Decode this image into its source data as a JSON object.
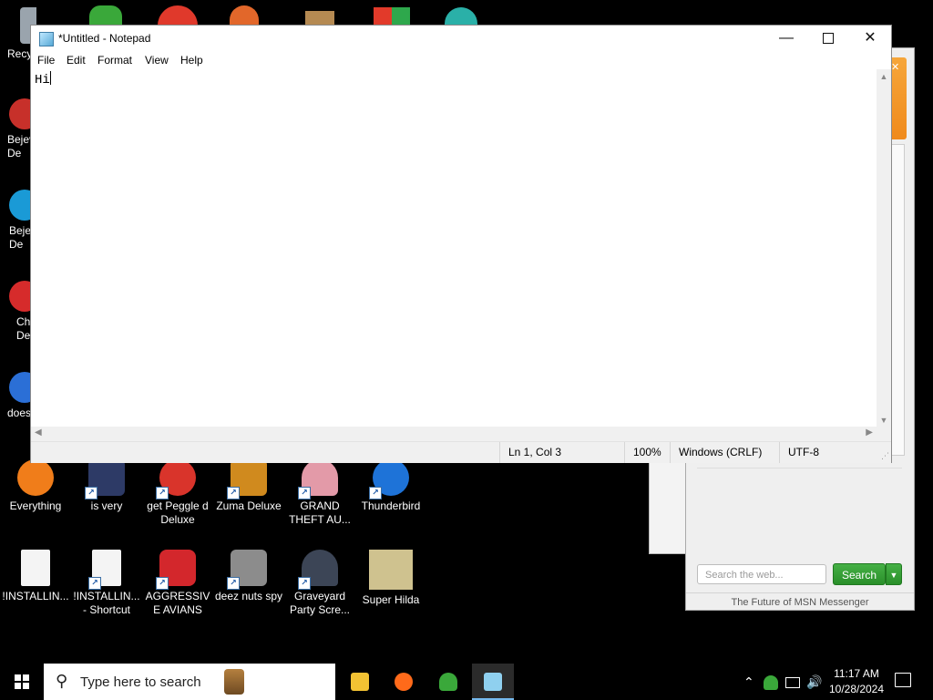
{
  "desktop": {
    "partial_icons": [
      {
        "label": "Recy",
        "icon": "recycle-bin-icon"
      },
      {
        "label": "Bejev\nDe",
        "icon": "bejeweled-icon"
      },
      {
        "label": "Beje\nDe",
        "icon": "bejeweled-2-icon"
      },
      {
        "label": "Ch\nDe",
        "icon": "chuzzle-icon"
      },
      {
        "label": "does",
        "icon": "app-icon"
      }
    ],
    "row1": [
      {
        "label": "Everything",
        "icon": "everything-search-icon",
        "color": "#f07d1a",
        "shortcut": false
      },
      {
        "label": "is very",
        "icon": "shield-logo-icon",
        "color": "#2d3a66",
        "shortcut": true
      },
      {
        "label": "get Peggle d Deluxe",
        "icon": "peggle-icon",
        "color": "#d9342b",
        "shortcut": true
      },
      {
        "label": "Zuma Deluxe",
        "icon": "zuma-icon",
        "color": "#d08a1e",
        "shortcut": true
      },
      {
        "label": "GRAND THEFT AU...",
        "icon": "anime-character-icon",
        "color": "#e39aa8",
        "shortcut": true
      },
      {
        "label": "Thunderbird",
        "icon": "thunderbird-icon",
        "color": "#1e73d8",
        "shortcut": false
      }
    ],
    "row2": [
      {
        "label": "!INSTALLIN...",
        "icon": "text-document-icon",
        "color": "#f4f4f4",
        "shortcut": false
      },
      {
        "label": "!INSTALLIN... - Shortcut",
        "icon": "text-document-icon",
        "color": "#f4f4f4",
        "shortcut": true
      },
      {
        "label": "AGGRESSIVE AVIANS",
        "icon": "angry-bird-icon",
        "color": "#d3272c",
        "shortcut": true
      },
      {
        "label": "deez nuts spy",
        "icon": "stacked-windows-icon",
        "color": "#8c8c8c",
        "shortcut": true
      },
      {
        "label": "Graveyard Party Scre...",
        "icon": "graveyard-icon",
        "color": "#3c4556",
        "shortcut": true
      },
      {
        "label": "Super Hilda",
        "icon": "pixel-dog-icon",
        "color": "#cfc28f",
        "shortcut": false
      }
    ]
  },
  "msn": {
    "search_placeholder": "Search the web...",
    "search_button": "Search",
    "tagline": "The Future of MSN Messenger"
  },
  "notepad": {
    "title": "*Untitled - Notepad",
    "menu": [
      "File",
      "Edit",
      "Format",
      "View",
      "Help"
    ],
    "content": "Hi",
    "status": {
      "position": "Ln 1, Col 3",
      "zoom": "100%",
      "line_endings": "Windows (CRLF)",
      "encoding": "UTF-8"
    }
  },
  "taskbar": {
    "search_placeholder": "Type here to search",
    "apps": [
      {
        "name": "file-explorer-icon",
        "color": "#f2c233"
      },
      {
        "name": "firefox-icon",
        "color": "#ff6a1a"
      },
      {
        "name": "messenger-icon",
        "color": "#3aa83a"
      },
      {
        "name": "notepad-icon",
        "color": "#8fd0ef"
      }
    ],
    "time": "11:17 AM",
    "date": "10/28/2024"
  },
  "colors": {
    "accent": "#76b9ed",
    "msn_green": "#2a8f2a"
  }
}
